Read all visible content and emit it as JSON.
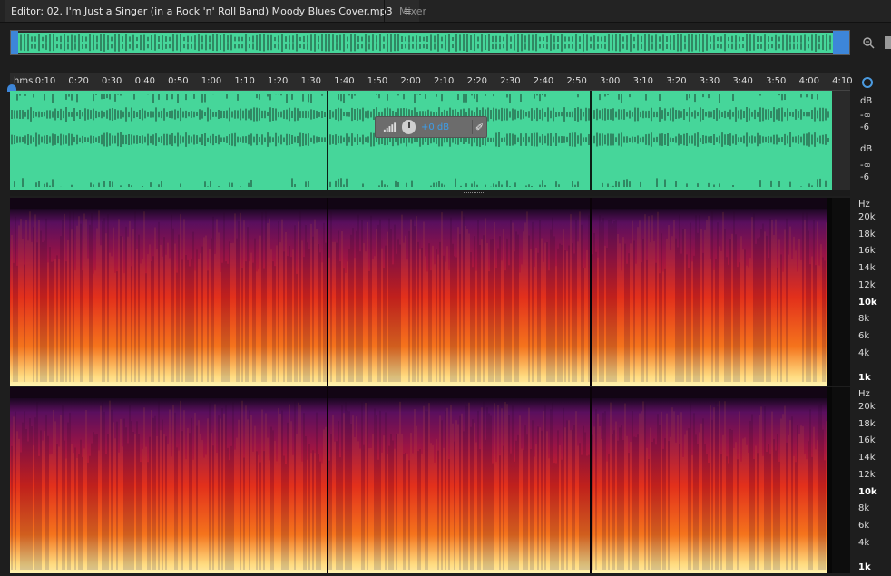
{
  "tabs": {
    "editor_title": "Editor: 02. I'm Just a Singer (in a Rock 'n' Roll Band)  Moody Blues Cover.mp3",
    "menu_glyph": "≡",
    "mixer": "Mixer"
  },
  "ruler": {
    "unit": "hms",
    "ticks": [
      "0:10",
      "0:20",
      "0:30",
      "0:40",
      "0:50",
      "1:00",
      "1:10",
      "1:20",
      "1:30",
      "1:40",
      "1:50",
      "2:00",
      "2:10",
      "2:20",
      "2:30",
      "2:40",
      "2:50",
      "3:00",
      "3:10",
      "3:20",
      "3:30",
      "3:40",
      "3:50",
      "4:00",
      "4:10"
    ]
  },
  "hud": {
    "value": "+0 dB",
    "pin_glyph": "✐"
  },
  "db_scale": {
    "ch1": {
      "unit": "dB",
      "inf": "-∞",
      "six": "-6"
    },
    "ch2": {
      "unit": "dB",
      "inf": "-∞",
      "six": "-6"
    }
  },
  "hz_scale": {
    "unit": "Hz",
    "labels": [
      "20k",
      "18k",
      "16k",
      "14k",
      "12k",
      "10k",
      "8k",
      "6k",
      "4k",
      "1k"
    ]
  },
  "colors": {
    "waveform": "#46d69a",
    "selection": "#3d86d9",
    "spec_low": "#ffe38a",
    "spec_mid": "#e0261a",
    "spec_high": "#5a0f5e"
  },
  "icons": [
    "zoom-icon",
    "panel-icon",
    "snap-icon",
    "volume-icon",
    "knob-icon",
    "pin-icon",
    "playhead-icon"
  ]
}
